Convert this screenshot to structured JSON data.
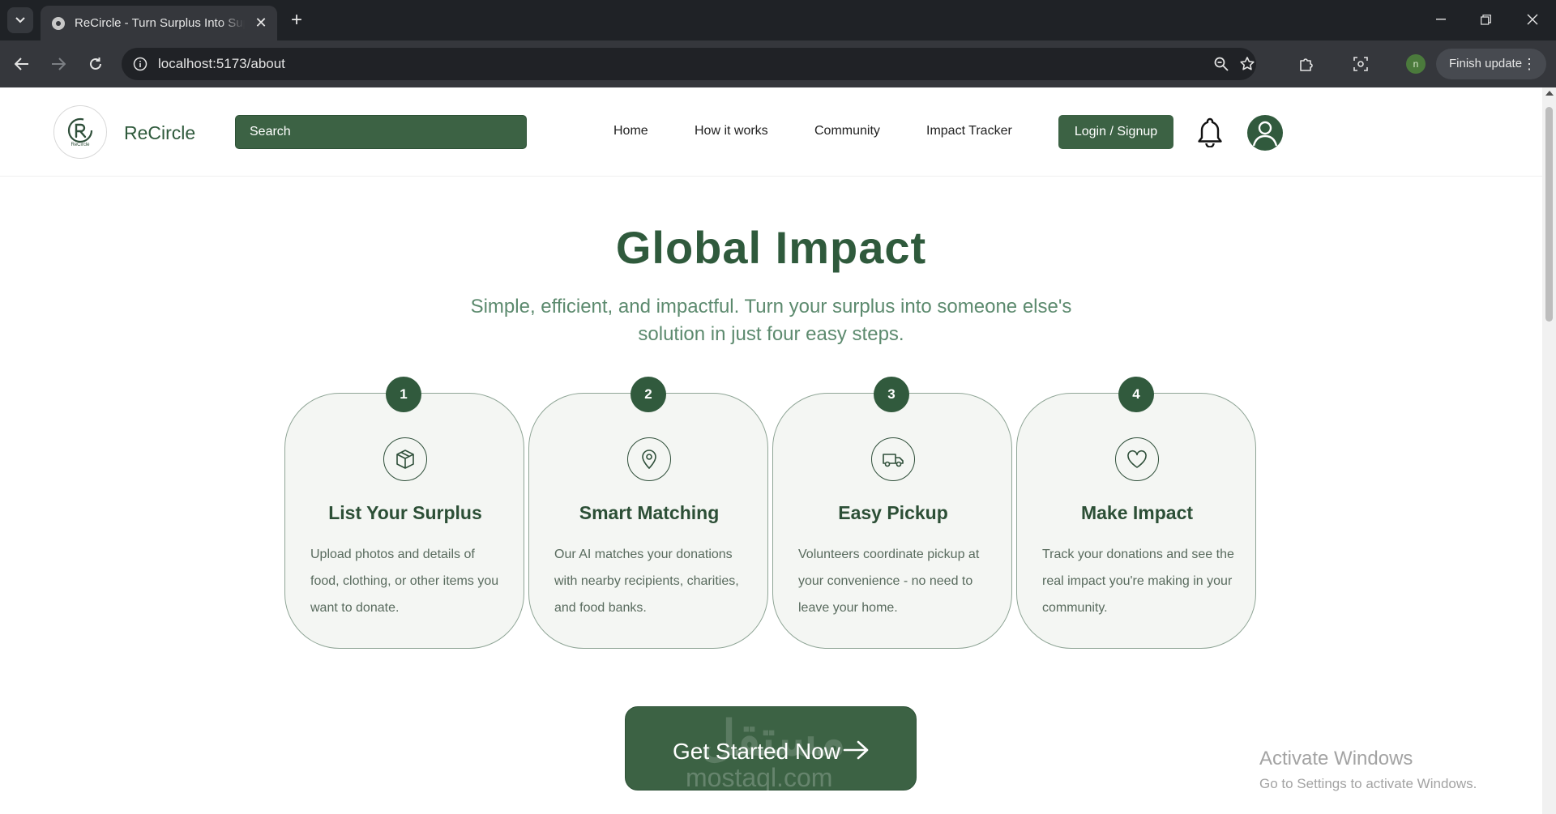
{
  "browser": {
    "tab_title": "ReCircle - Turn Surplus Into Supplies",
    "url": "localhost:5173/about",
    "profile_initial": "n",
    "finish_update": "Finish update"
  },
  "header": {
    "brand": "ReCircle",
    "logo_text": "ReCircle",
    "search_placeholder": "Search",
    "nav": [
      "Home",
      "How it works",
      "Community",
      "Impact Tracker"
    ],
    "login": "Login / Signup"
  },
  "hero": {
    "title": "Global Impact",
    "subtitle": "Simple, efficient, and impactful. Turn your surplus into someone else's solution in just four easy steps."
  },
  "steps": [
    {
      "number": "1",
      "icon": "box-icon",
      "title": "List Your Surplus",
      "desc": "Upload photos and details of food, clothing, or other items you want to donate."
    },
    {
      "number": "2",
      "icon": "map-pin-icon",
      "title": "Smart Matching",
      "desc": "Our AI matches your donations with nearby recipients, charities, and food banks."
    },
    {
      "number": "3",
      "icon": "truck-icon",
      "title": "Easy Pickup",
      "desc": "Volunteers coordinate pickup at your convenience - no need to leave your home."
    },
    {
      "number": "4",
      "icon": "heart-icon",
      "title": "Make Impact",
      "desc": "Track your donations and see the real impact you're making in your community."
    }
  ],
  "cta": {
    "label": "Get Started Now"
  },
  "watermark": {
    "arabic": "مستقل",
    "latin": "mostaql.com"
  },
  "activation": {
    "title": "Activate Windows",
    "subtitle": "Go to Settings to activate Windows."
  },
  "colors": {
    "brand_green": "#3c6244",
    "dark_green": "#315a3d",
    "card_bg": "#f4f6f3",
    "subtitle_green": "#5c8a6e"
  }
}
